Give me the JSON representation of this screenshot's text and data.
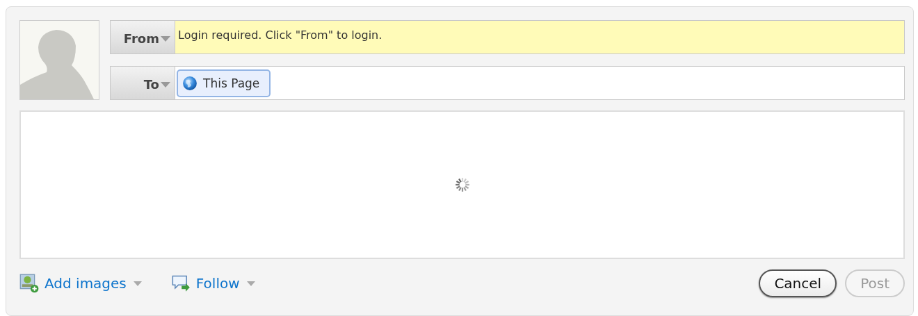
{
  "from": {
    "label": "From",
    "message": "Login required. Click \"From\" to login."
  },
  "to": {
    "label": "To",
    "recipients": [
      {
        "label": "This Page"
      }
    ]
  },
  "actions": [
    {
      "kind": "images",
      "label": "Add images"
    },
    {
      "kind": "follow",
      "label": "Follow"
    }
  ],
  "buttons": [
    {
      "label": "Cancel",
      "disabled": false
    },
    {
      "label": "Post",
      "disabled": true
    }
  ]
}
